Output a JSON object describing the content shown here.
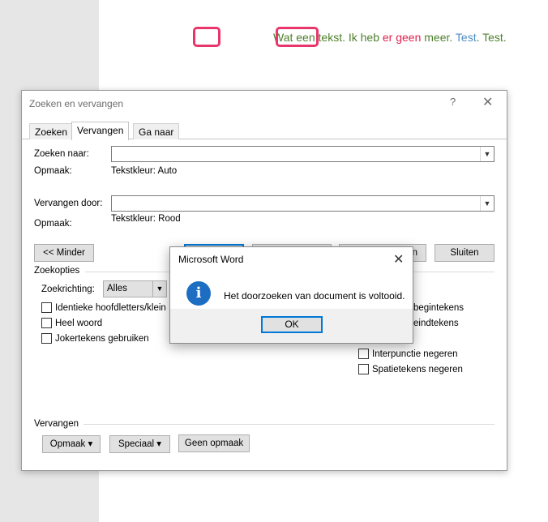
{
  "document": {
    "seg1": "Wat ",
    "seg2": "een",
    "seg3": " tekst. Ik heb ",
    "seg4": "er geen",
    "seg5": " meer. ",
    "seg6": "Test",
    "seg7": ". Test."
  },
  "dialog": {
    "title": "Zoeken en vervangen",
    "help": "?",
    "close": "✕",
    "tabs": [
      "Zoeken",
      "Vervangen",
      "Ga naar"
    ],
    "find_label": "Zoeken naar:",
    "find_value": "",
    "find_format_label": "Opmaak:",
    "find_format_value": "Tekstkleur: Auto",
    "replace_label": "Vervangen door:",
    "replace_value": "",
    "replace_format_label": "Opmaak:",
    "replace_format_value": "Tekstkleur: Rood",
    "less_button": "<< Minder",
    "replace_all_partial": "n",
    "close_button": "Sluiten",
    "search_options_header": "Zoekopties",
    "direction_label": "Zoekrichting:",
    "direction_value": "Alles",
    "options_left": [
      "Identieke hoofdletters/klein",
      "Heel woord",
      "Jokertekens gebruiken"
    ],
    "options_right_partial": [
      "begintekens",
      "eindtekens"
    ],
    "options_right": [
      "Interpunctie negeren",
      "Spatietekens negeren"
    ],
    "replace_section_header": "Vervangen",
    "format_button": "Opmaak ▾",
    "special_button": "Speciaal ▾",
    "no_format_button": "Geen opmaak"
  },
  "message_box": {
    "title": "Microsoft Word",
    "close": "✕",
    "icon": "info-icon",
    "text": "Het doorzoeken van document is voltooid.",
    "ok": "OK"
  },
  "colors": {
    "doc_green": "#4e7f2c",
    "doc_blue": "#4e8cc2",
    "doc_red": "#e0214e",
    "highlight": "#e8356b",
    "focus_blue": "#0078d7"
  }
}
